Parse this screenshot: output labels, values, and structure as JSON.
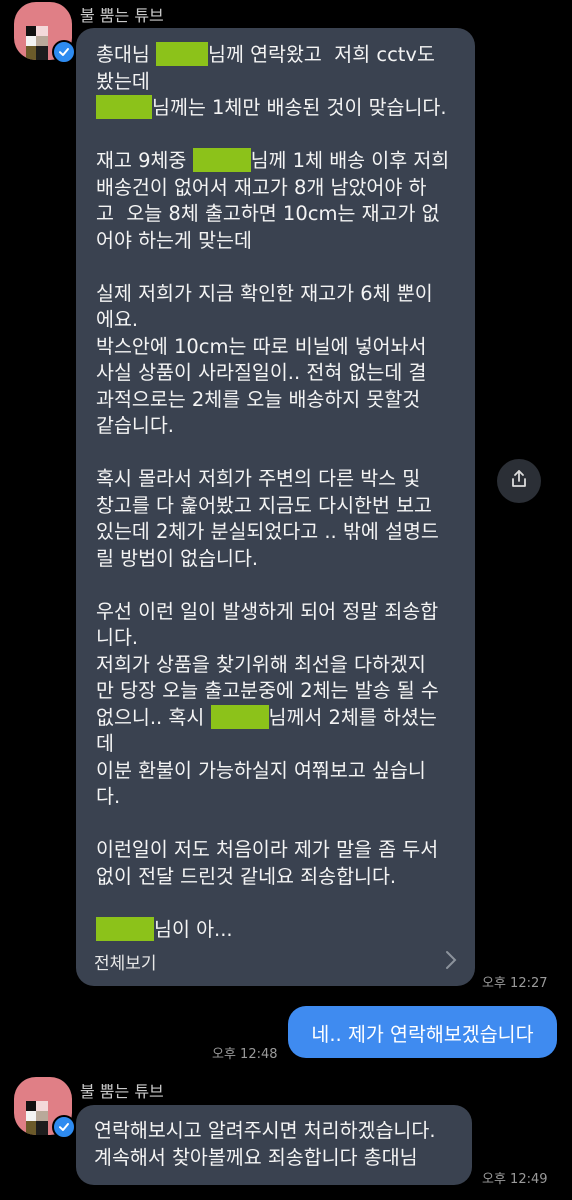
{
  "chat": {
    "sender_name": "불 뿜는 튜브",
    "messages": [
      {
        "direction": "incoming",
        "lines": [
          [
            "총대님 ",
            {
              "mask": 52
            },
            "님께 연락왔고  저희 cctv도"
          ],
          [
            "봤는데"
          ],
          [
            {
              "mask": 56
            },
            "님께는 1체만 배송된 것이 맞습니다."
          ],
          [
            ""
          ],
          [
            "재고 9체중 ",
            {
              "mask": 58
            },
            "님께 1체 배송 이후 저희"
          ],
          [
            "배송건이 없어서 재고가 8개 남았어야 하"
          ],
          [
            "고  오늘 8체 출고하면 10cm는 재고가 없"
          ],
          [
            "어야 하는게 맞는데"
          ],
          [
            ""
          ],
          [
            "실제 저희가 지금 확인한 재고가 6체 뿐이"
          ],
          [
            "에요."
          ],
          [
            "박스안에 10cm는 따로 비닐에 넣어놔서"
          ],
          [
            "사실 상품이 사라질일이.. 전혀 없는데 결"
          ],
          [
            "과적으로는 2체를 오늘 배송하지 못할것"
          ],
          [
            "같습니다."
          ],
          [
            ""
          ],
          [
            "혹시 몰라서 저희가 주변의 다른 박스 및"
          ],
          [
            "창고를 다 훑어봤고 지금도 다시한번 보고"
          ],
          [
            "있는데 2체가 분실되었다고 .. 밖에 설명드"
          ],
          [
            "릴 방법이 없습니다."
          ],
          [
            ""
          ],
          [
            "우선 이런 일이 발생하게 되어 정말 죄송합"
          ],
          [
            "니다."
          ],
          [
            "저희가 상품을 찾기위해 최선을 다하겠지"
          ],
          [
            "만 당장 오늘 출고분중에 2체는 발송 될 수"
          ],
          [
            "없으니.. 혹시 ",
            {
              "mask": 58
            },
            "님께서 2체를 하셨는"
          ],
          [
            "데"
          ],
          [
            "이분 환불이 가능하실지 여쭤보고 싶습니"
          ],
          [
            "다."
          ],
          [
            ""
          ],
          [
            "이런일이 저도 처음이라 제가 말을 좀 두서"
          ],
          [
            "없이 전달 드린것 같네요 죄송합니다."
          ],
          [
            ""
          ],
          [
            {
              "mask": 58
            },
            "님이 아..."
          ]
        ],
        "see_all_label": "전체보기",
        "time": "오후 12:27"
      },
      {
        "direction": "outgoing",
        "text": "네.. 제가 연락해보겠습니다",
        "time": "오후 12:48"
      },
      {
        "direction": "incoming",
        "lines": [
          [
            "연락해보시고 알려주시면 처리하겠습니다."
          ],
          [
            "계속해서 찾아볼께요 죄송합니다 총대님"
          ]
        ],
        "time": "오후 12:49"
      }
    ]
  },
  "icons": {
    "verified": "verified-badge-icon",
    "share": "share-icon",
    "chevron": "chevron-right-icon"
  },
  "colors": {
    "background": "#000000",
    "incoming_bubble": "#3a4250",
    "outgoing_bubble": "#3f8bf0",
    "mask": "#8cc21a",
    "avatar": "#e07f86",
    "badge": "#2e8bf0"
  }
}
